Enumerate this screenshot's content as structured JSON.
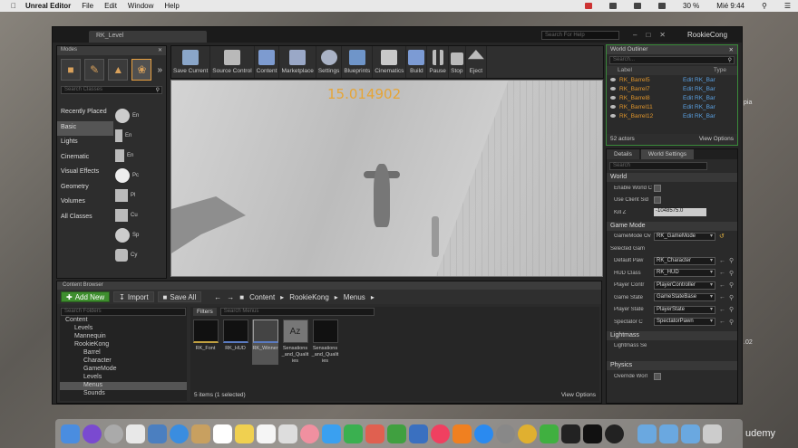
{
  "menubar": {
    "app": "Unreal Editor",
    "items": [
      "File",
      "Edit",
      "Window",
      "Help"
    ],
    "battery": "30 %",
    "time": "Mié 9:44"
  },
  "window": {
    "tab": "RK_Level",
    "help_search": "Search For Help",
    "user": "RookieCong"
  },
  "modes": {
    "title": "Modes",
    "search": "Search Classes",
    "categories": [
      "Recently Placed",
      "Basic",
      "Lights",
      "Cinematic",
      "Visual Effects",
      "Geometry",
      "Volumes",
      "All Classes"
    ],
    "selected": "Basic",
    "items": [
      "En",
      "En",
      "En",
      "Pc",
      "Pl",
      "Cu",
      "Sp",
      "Cy"
    ]
  },
  "toolbar": {
    "buttons": [
      "Save Current",
      "Source Control",
      "Content",
      "Marketplace",
      "Settings",
      "Blueprints",
      "Cinematics",
      "Build",
      "Pause",
      "Stop",
      "Eject"
    ]
  },
  "viewport": {
    "timer": "15.014902"
  },
  "outliner": {
    "title": "World Outliner",
    "search": "Search...",
    "col_label": "Label",
    "col_type": "Type",
    "rows": [
      {
        "name": "RK_Barrel5",
        "type": "Edit RK_Bar"
      },
      {
        "name": "RK_Barrel7",
        "type": "Edit RK_Bar"
      },
      {
        "name": "RK_Barrel8",
        "type": "Edit RK_Bar"
      },
      {
        "name": "RK_Barrel11",
        "type": "Edit RK_Bar"
      },
      {
        "name": "RK_Barrel12",
        "type": "Edit RK_Bar"
      }
    ],
    "count": "52 actors",
    "view_options": "View Options"
  },
  "details": {
    "tab_details": "Details",
    "tab_world": "World Settings",
    "search": "Search",
    "sec_world": "World",
    "enable_world": "Enable World C",
    "use_client": "Use Client Sid",
    "kill_z": "Kill Z",
    "kill_z_val": "-1048575.0",
    "sec_game": "Game Mode",
    "gamemode_label": "GameMode Ov",
    "gamemode_val": "RK_GameMode",
    "selected": "Selected Gam",
    "pawn_label": "Default Paw",
    "pawn_val": "RK_Character",
    "hud_label": "HUD Class",
    "hud_val": "RK_HUD",
    "pc_label": "Player Contr",
    "pc_val": "PlayerController",
    "gs_label": "Game State",
    "gs_val": "GameStateBase",
    "ps_label": "Player State",
    "ps_val": "PlayerState",
    "spec_label": "Spectator C",
    "spec_val": "SpectatorPawn",
    "sec_light": "Lightmass",
    "light_row": "Lightmass Se",
    "sec_phys": "Physics",
    "override": "Override Worl"
  },
  "content": {
    "title": "Content Browser",
    "add": "Add New",
    "import": "Import",
    "saveall": "Save All",
    "crumbs": [
      "Content",
      "RookieKong",
      "Menus"
    ],
    "tree_search": "Search Folders",
    "tree": [
      "Content",
      "Levels",
      "Mannequin",
      "RookieKong",
      "Barrel",
      "Character",
      "GameMode",
      "Levels",
      "Menus",
      "Sounds"
    ],
    "filters": "Filters",
    "asset_search": "Search Menus",
    "assets": [
      "RK_Font",
      "RK_HUD",
      "RK_Winner",
      "Sensations_and_Qualities",
      "Sensations_and_Qualities"
    ],
    "status": "5 items (1 selected)",
    "view_options": "View Options"
  },
  "side": {
    "a": "pia",
    "b": ".02"
  },
  "brand": "udemy"
}
